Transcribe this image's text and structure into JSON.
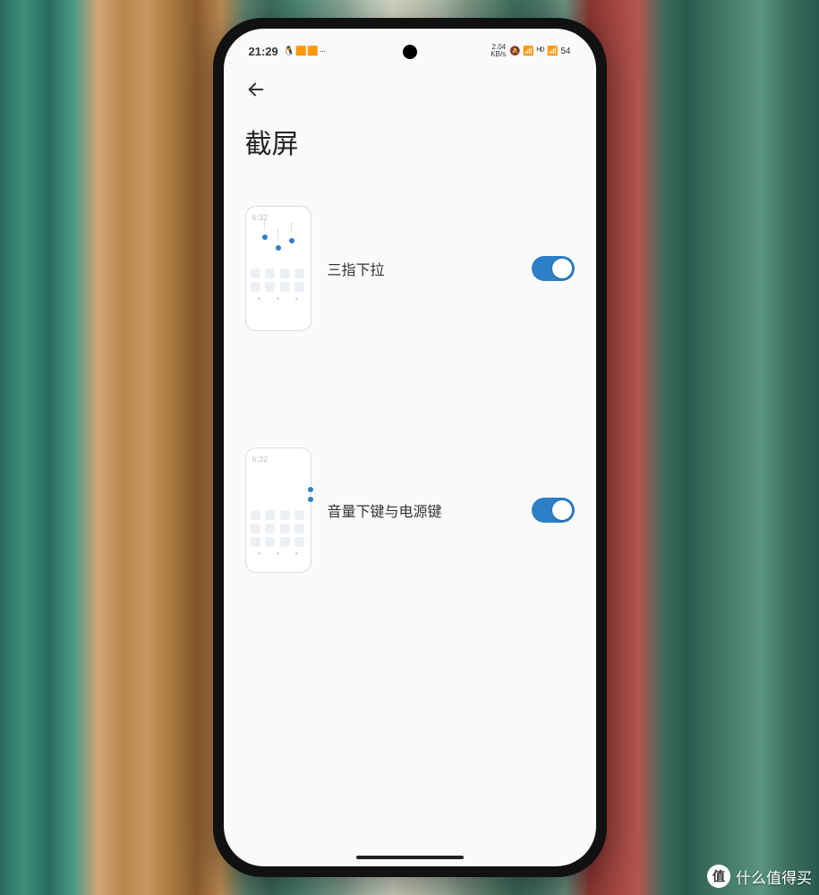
{
  "status_bar": {
    "time": "21:29",
    "notif_icons": "🐧 🟧 🟧 ···",
    "net_speed": "2.04",
    "net_unit": "KB/s",
    "indicators": "🔕 📶 ᴴᴰ 📶 54"
  },
  "header": {
    "title": "截屏"
  },
  "illustration": {
    "time": "6:32"
  },
  "settings": [
    {
      "label": "三指下拉",
      "enabled": true
    },
    {
      "label": "音量下键与电源键",
      "enabled": true
    }
  ],
  "watermark": {
    "badge": "值",
    "text": "什么值得买"
  }
}
